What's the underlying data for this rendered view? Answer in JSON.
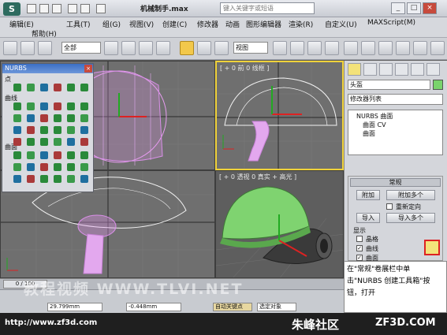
{
  "titlebar": {
    "title": "机械制手.max",
    "help_placeholder": "键入关键字或短语",
    "minimize": "_",
    "maximize": "□",
    "close": "×"
  },
  "menubar": {
    "items": [
      "编辑(E)",
      "工具(T)",
      "组(G)",
      "视图(V)",
      "创建(C)",
      "修改器",
      "动画",
      "图形编辑器",
      "渲染(R)",
      "自定义(U)",
      "MAXScript(M)",
      "帮助(H)"
    ]
  },
  "toolbar": {
    "filter_value": "全部",
    "refcoord_value": "视图"
  },
  "viewports": {
    "top_label": "",
    "front_label": "[ + 0 前 0 线框 ]",
    "left_label": "",
    "persp_label": "[ + 0 透视 0 真实 + 高光 ]"
  },
  "nurbs_palette": {
    "title": "NURBS",
    "close": "×",
    "section_points": "点",
    "section_curves": "曲线",
    "section_surfaces": "曲面"
  },
  "command_panel": {
    "object_name": "头盔",
    "modifier_list": "修改器列表",
    "stack_items": [
      "NURBS 曲面",
      "曲面 CV",
      "曲面"
    ],
    "rollout_title": "常规",
    "attach": "附加",
    "attach_multiple": "附加多个",
    "reorient": "重新定向",
    "import": "导入",
    "import_multiple": "导入多个",
    "display_label": "显示",
    "lattice": "晶格",
    "curves": "曲线",
    "surfaces": "曲面"
  },
  "callout": {
    "text": "在\"常规\"卷展栏中单击\"NURBS 创建工具箱\"按钮，打开"
  },
  "timebar": {
    "frame": "0 / 100"
  },
  "statusbar": {
    "coord_x": "29.799mm",
    "coord_y": "-0.448mm",
    "auto_key": "自动关键点",
    "selected": "选定对象"
  },
  "footer": {
    "url": "http://www.zf3d.com",
    "brand": "朱峰社区",
    "site": "ZF3D.COM"
  },
  "watermark": "教程视频  WWW.TLVI.NET"
}
